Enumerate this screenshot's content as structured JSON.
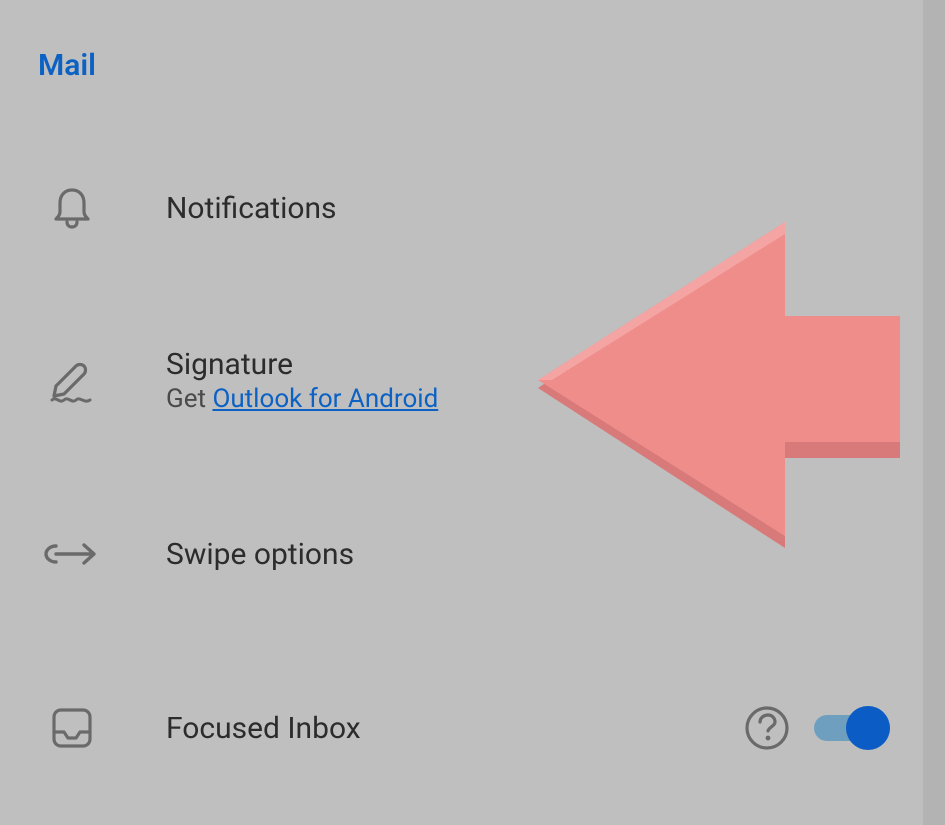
{
  "section": {
    "title": "Mail"
  },
  "rows": {
    "notifications": {
      "title": "Notifications"
    },
    "signature": {
      "title": "Signature",
      "sub_prefix": "Get ",
      "sub_link": "Outlook for Android"
    },
    "swipe": {
      "title": "Swipe options"
    },
    "focused": {
      "title": "Focused Inbox"
    }
  }
}
